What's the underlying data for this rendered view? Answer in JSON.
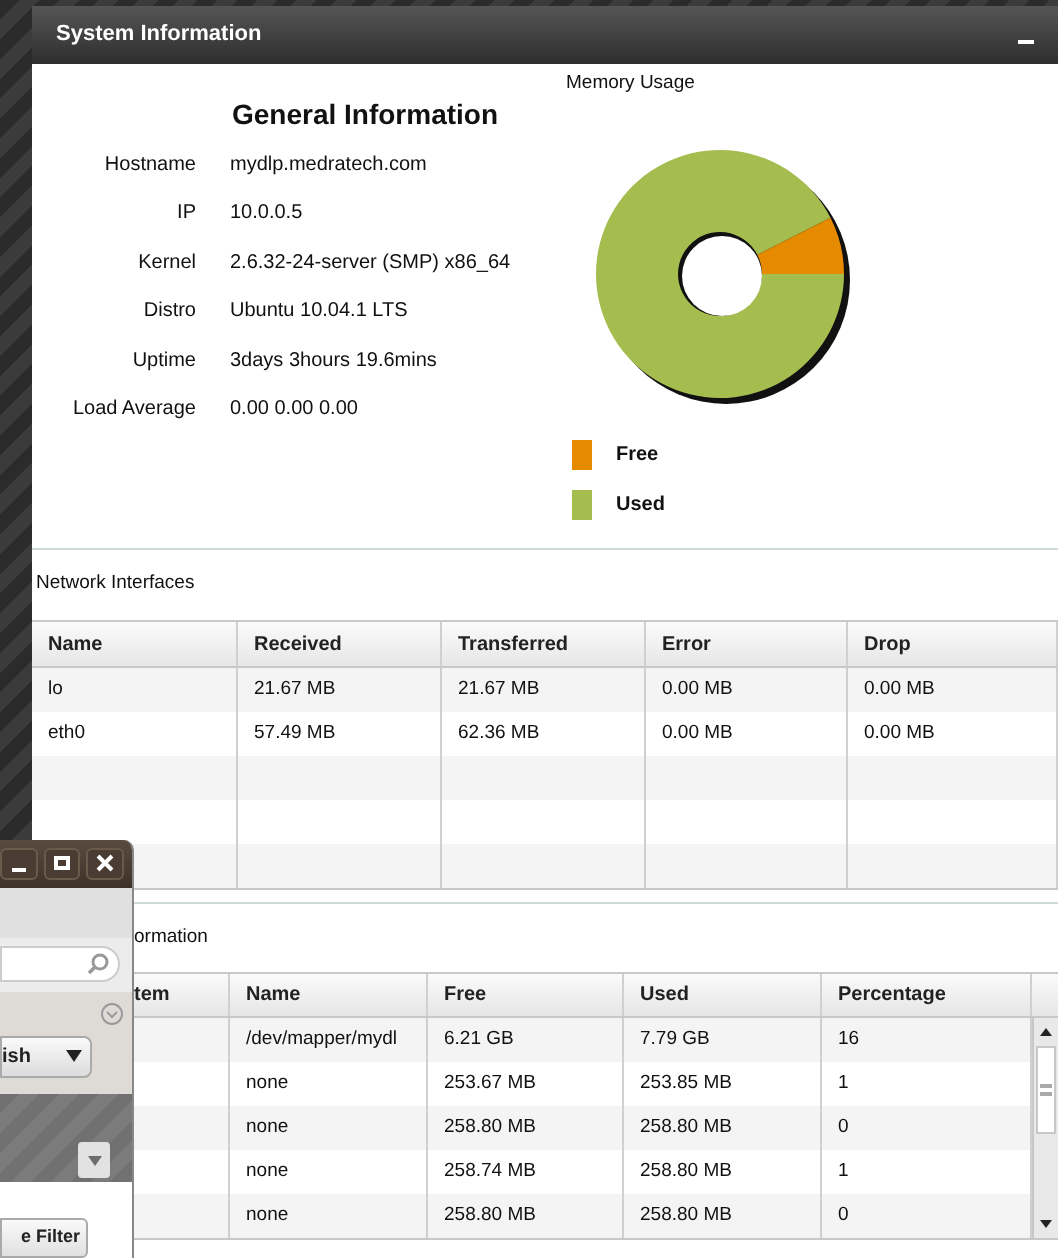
{
  "panel": {
    "title": "System Information"
  },
  "general": {
    "heading": "General Information",
    "rows": [
      {
        "label": "Hostname",
        "value": "mydlp.medratech.com"
      },
      {
        "label": "IP",
        "value": "10.0.0.5"
      },
      {
        "label": "Kernel",
        "value": "2.6.32-24-server (SMP) x86_64"
      },
      {
        "label": "Distro",
        "value": "Ubuntu 10.04.1 LTS"
      },
      {
        "label": "Uptime",
        "value": "3days 3hours 19.6mins"
      },
      {
        "label": "Load Average",
        "value": "0.00 0.00 0.00"
      }
    ]
  },
  "memory": {
    "title": "Memory Usage",
    "legend": [
      {
        "label": "Free",
        "color": "#e68a00"
      },
      {
        "label": "Used",
        "color": "#a5bd4f"
      }
    ]
  },
  "network": {
    "title": "Network Interfaces",
    "columns": [
      "Name",
      "Received",
      "Transferred",
      "Error",
      "Drop"
    ],
    "rows": [
      [
        "lo",
        "21.67 MB",
        "21.67 MB",
        "0.00 MB",
        "0.00 MB"
      ],
      [
        "eth0",
        "57.49 MB",
        "62.36 MB",
        "0.00 MB",
        "0.00 MB"
      ]
    ]
  },
  "disk": {
    "title": "ormation",
    "columns": [
      "tem",
      "Name",
      "Free",
      "Used",
      "Percentage"
    ],
    "rows": [
      [
        "",
        "/dev/mapper/mydl",
        "6.21 GB",
        "7.79 GB",
        "16"
      ],
      [
        "",
        "none",
        "253.67 MB",
        "253.85 MB",
        "1"
      ],
      [
        "",
        "none",
        "258.80 MB",
        "258.80 MB",
        "0"
      ],
      [
        "",
        "none",
        "258.74 MB",
        "258.80 MB",
        "1"
      ],
      [
        "",
        "none",
        "258.80 MB",
        "258.80 MB",
        "0"
      ]
    ]
  },
  "overlay_window": {
    "dropdown": "ish",
    "button": "e Filter"
  }
}
